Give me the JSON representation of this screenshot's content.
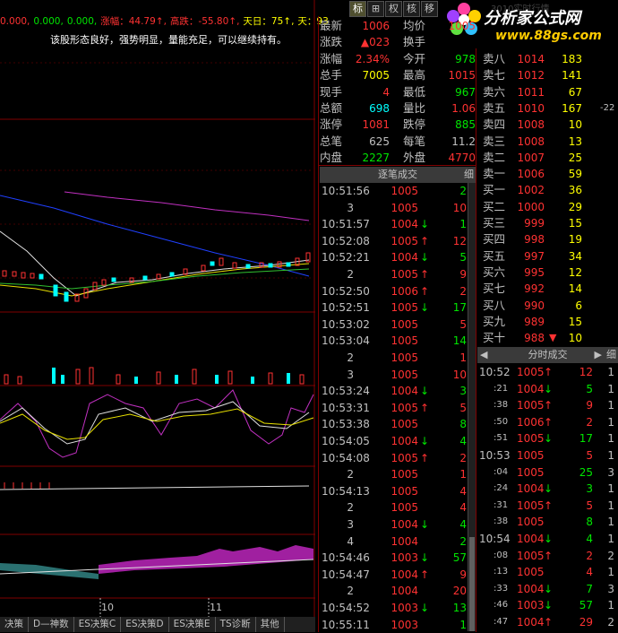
{
  "chart": {
    "header": [
      {
        "text": "0.000,",
        "color": "#ff3232"
      },
      {
        "text": "0.000,",
        "color": "#00e600"
      },
      {
        "text": "0.000,",
        "color": "#00e600"
      },
      {
        "text": "涨幅：44.79↑,",
        "color": "#ff3232"
      },
      {
        "text": "高跌：-55.80↑,",
        "color": "#ff3232"
      },
      {
        "text": "天日：75↑,",
        "color": "#ffff00"
      },
      {
        "text": "天：93",
        "color": "#ffff00"
      }
    ],
    "message": "该股形态良好，强势明显，量能充足，可以继续持有。",
    "date_markers": [
      "10",
      "11"
    ],
    "right_axis_label": "-22"
  },
  "tabs": [
    "决策",
    "D—神数",
    "ES决策C",
    "ES决策D",
    "ES决策E",
    "TS诊断",
    "其他"
  ],
  "toolbar": {
    "buttons": [
      "标",
      "⊞",
      "权",
      "核",
      "移"
    ]
  },
  "logo": {
    "title": "分析家公式网",
    "url": "www.88gs.com",
    "faded_text": "3010实时行情"
  },
  "quote": {
    "rows": [
      {
        "l1": "最新",
        "v1": "1006",
        "c1": "#ff3232",
        "l2": "均价",
        "v2": "1005",
        "c2": "#ff3232"
      },
      {
        "l1": "涨跌",
        "v1": "▲023",
        "c1": "#ff3232",
        "l2": "换手",
        "v2": "",
        "c2": "#c0c0c0"
      },
      {
        "l1": "涨幅",
        "v1": "2.34%",
        "c1": "#ff3232",
        "l2": "今开",
        "v2": "978",
        "c2": "#00e600"
      },
      {
        "l1": "总手",
        "v1": "7005",
        "c1": "#ffff00",
        "l2": "最高",
        "v2": "1015",
        "c2": "#ff3232"
      },
      {
        "l1": "现手",
        "v1": "4",
        "c1": "#ff3232",
        "l2": "最低",
        "v2": "967",
        "c2": "#00e600"
      },
      {
        "l1": "总额",
        "v1": "698",
        "c1": "#00ffff",
        "l2": "量比",
        "v2": "1.06",
        "c2": "#ff3232"
      },
      {
        "l1": "涨停",
        "v1": "1081",
        "c1": "#ff3232",
        "l2": "跌停",
        "v2": "885",
        "c2": "#00e600"
      },
      {
        "l1": "总笔",
        "v1": "625",
        "c1": "#c0c0c0",
        "l2": "每笔",
        "v2": "11.2",
        "c2": "#c0c0c0"
      },
      {
        "l1": "内盘",
        "v1": "2227",
        "c1": "#00e600",
        "l2": "外盘",
        "v2": "4770",
        "c2": "#ff3232"
      }
    ],
    "orderbook": [
      {
        "label": "卖八",
        "price": "1014",
        "pc": "#ff3232",
        "vol": "183"
      },
      {
        "label": "卖七",
        "price": "1012",
        "pc": "#ff3232",
        "vol": "141"
      },
      {
        "label": "卖六",
        "price": "1011",
        "pc": "#ff3232",
        "vol": "67"
      },
      {
        "label": "卖五",
        "price": "1010",
        "pc": "#ff3232",
        "vol": "167"
      },
      {
        "label": "卖四",
        "price": "1008",
        "pc": "#ff3232",
        "vol": "10"
      },
      {
        "label": "卖三",
        "price": "1008",
        "pc": "#ff3232",
        "vol": "13"
      },
      {
        "label": "卖二",
        "price": "1007",
        "pc": "#ff3232",
        "vol": "25"
      },
      {
        "label": "卖一",
        "price": "1006",
        "pc": "#ff3232",
        "vol": "59"
      },
      {
        "label": "买一",
        "price": "1002",
        "pc": "#ff3232",
        "vol": "36"
      },
      {
        "label": "买二",
        "price": "1000",
        "pc": "#ff3232",
        "vol": "29"
      },
      {
        "label": "买三",
        "price": "999",
        "pc": "#ff3232",
        "vol": "15"
      },
      {
        "label": "买四",
        "price": "998",
        "pc": "#ff3232",
        "vol": "19"
      },
      {
        "label": "买五",
        "price": "997",
        "pc": "#ff3232",
        "vol": "34"
      },
      {
        "label": "买六",
        "price": "995",
        "pc": "#ff3232",
        "vol": "12"
      },
      {
        "label": "买七",
        "price": "992",
        "pc": "#ff3232",
        "vol": "14"
      },
      {
        "label": "买八",
        "price": "990",
        "pc": "#ff3232",
        "vol": "6"
      },
      {
        "label": "买九",
        "price": "989",
        "pc": "#ff3232",
        "vol": "15"
      },
      {
        "label": "买十",
        "price": "988",
        "pc": "#ff3232",
        "vol": "10"
      }
    ]
  },
  "trades": {
    "title": "逐笔成交",
    "detail_label": "细",
    "rows": [
      {
        "time": "10:51:56",
        "price": "1005",
        "arrow": "",
        "vol": "2",
        "vc": "#00e600"
      },
      {
        "time": "3",
        "price": "1005",
        "arrow": "",
        "vol": "10",
        "vc": "#ff3232"
      },
      {
        "time": "10:51:57",
        "price": "1004",
        "arrow": "↓",
        "vol": "1",
        "vc": "#00e600"
      },
      {
        "time": "10:52:08",
        "price": "1005",
        "arrow": "↑",
        "vol": "12",
        "vc": "#ff3232"
      },
      {
        "time": "10:52:21",
        "price": "1004",
        "arrow": "↓",
        "vol": "5",
        "vc": "#00e600"
      },
      {
        "time": "2",
        "price": "1005",
        "arrow": "↑",
        "vol": "9",
        "vc": "#ff3232"
      },
      {
        "time": "10:52:50",
        "price": "1006",
        "arrow": "↑",
        "vol": "2",
        "vc": "#ff3232"
      },
      {
        "time": "10:52:51",
        "price": "1005",
        "arrow": "↓",
        "vol": "17",
        "vc": "#00e600"
      },
      {
        "time": "10:53:02",
        "price": "1005",
        "arrow": "",
        "vol": "5",
        "vc": "#ff3232"
      },
      {
        "time": "10:53:04",
        "price": "1005",
        "arrow": "",
        "vol": "14",
        "vc": "#00e600"
      },
      {
        "time": "2",
        "price": "1005",
        "arrow": "",
        "vol": "1",
        "vc": "#ff3232"
      },
      {
        "time": "3",
        "price": "1005",
        "arrow": "",
        "vol": "10",
        "vc": "#ff3232"
      },
      {
        "time": "10:53:24",
        "price": "1004",
        "arrow": "↓",
        "vol": "3",
        "vc": "#00e600"
      },
      {
        "time": "10:53:31",
        "price": "1005",
        "arrow": "↑",
        "vol": "5",
        "vc": "#ff3232"
      },
      {
        "time": "10:53:38",
        "price": "1005",
        "arrow": "",
        "vol": "8",
        "vc": "#00e600"
      },
      {
        "time": "10:54:05",
        "price": "1004",
        "arrow": "↓",
        "vol": "4",
        "vc": "#00e600"
      },
      {
        "time": "10:54:08",
        "price": "1005",
        "arrow": "↑",
        "vol": "2",
        "vc": "#ff3232"
      },
      {
        "time": "2",
        "price": "1005",
        "arrow": "",
        "vol": "1",
        "vc": "#ff3232"
      },
      {
        "time": "10:54:13",
        "price": "1005",
        "arrow": "",
        "vol": "4",
        "vc": "#ff3232"
      },
      {
        "time": "2",
        "price": "1005",
        "arrow": "",
        "vol": "4",
        "vc": "#ff3232"
      },
      {
        "time": "3",
        "price": "1004",
        "arrow": "↓",
        "vol": "4",
        "vc": "#00e600"
      },
      {
        "time": "4",
        "price": "1004",
        "arrow": "",
        "vol": "2",
        "vc": "#00e600"
      },
      {
        "time": "10:54:46",
        "price": "1003",
        "arrow": "↓",
        "vol": "57",
        "vc": "#00e600"
      },
      {
        "time": "10:54:47",
        "price": "1004",
        "arrow": "↑",
        "vol": "9",
        "vc": "#ff3232"
      },
      {
        "time": "2",
        "price": "1004",
        "arrow": "",
        "vol": "20",
        "vc": "#ff3232"
      },
      {
        "time": "10:54:52",
        "price": "1003",
        "arrow": "↓",
        "vol": "13",
        "vc": "#00e600"
      },
      {
        "time": "10:55:11",
        "price": "1003",
        "arrow": "",
        "vol": "1",
        "vc": "#00e600"
      }
    ]
  },
  "minute_trades": {
    "title": "分时成交",
    "detail_label": "细",
    "rows": [
      {
        "time": "10:52",
        "price": "1005",
        "arrow": "↑",
        "vol": "12",
        "n": "1",
        "vc": "#ff3232"
      },
      {
        "time": ":21",
        "price": "1004",
        "arrow": "↓",
        "vol": "5",
        "n": "1",
        "vc": "#00e600"
      },
      {
        "time": ":38",
        "price": "1005",
        "arrow": "↑",
        "vol": "9",
        "n": "1",
        "vc": "#ff3232"
      },
      {
        "time": ":50",
        "price": "1006",
        "arrow": "↑",
        "vol": "2",
        "n": "1",
        "vc": "#ff3232"
      },
      {
        "time": ":51",
        "price": "1005",
        "arrow": "↓",
        "vol": "17",
        "n": "1",
        "vc": "#00e600"
      },
      {
        "time": "10:53",
        "price": "1005",
        "arrow": "",
        "vol": "5",
        "n": "1",
        "vc": "#ff3232"
      },
      {
        "time": ":04",
        "price": "1005",
        "arrow": "",
        "vol": "25",
        "n": "3",
        "vc": "#00e600"
      },
      {
        "time": ":24",
        "price": "1004",
        "arrow": "↓",
        "vol": "3",
        "n": "1",
        "vc": "#00e600"
      },
      {
        "time": ":31",
        "price": "1005",
        "arrow": "↑",
        "vol": "5",
        "n": "1",
        "vc": "#ff3232"
      },
      {
        "time": ":38",
        "price": "1005",
        "arrow": "",
        "vol": "8",
        "n": "1",
        "vc": "#00e600"
      },
      {
        "time": "10:54",
        "price": "1004",
        "arrow": "↓",
        "vol": "4",
        "n": "1",
        "vc": "#00e600"
      },
      {
        "time": ":08",
        "price": "1005",
        "arrow": "↑",
        "vol": "2",
        "n": "2",
        "vc": "#ff3232"
      },
      {
        "time": ":13",
        "price": "1005",
        "arrow": "",
        "vol": "4",
        "n": "1",
        "vc": "#ff3232"
      },
      {
        "time": ":33",
        "price": "1004",
        "arrow": "↓",
        "vol": "7",
        "n": "3",
        "vc": "#00e600"
      },
      {
        "time": ":46",
        "price": "1003",
        "arrow": "↓",
        "vol": "57",
        "n": "1",
        "vc": "#00e600"
      },
      {
        "time": ":47",
        "price": "1004",
        "arrow": "↑",
        "vol": "29",
        "n": "2",
        "vc": "#ff3232"
      }
    ]
  }
}
